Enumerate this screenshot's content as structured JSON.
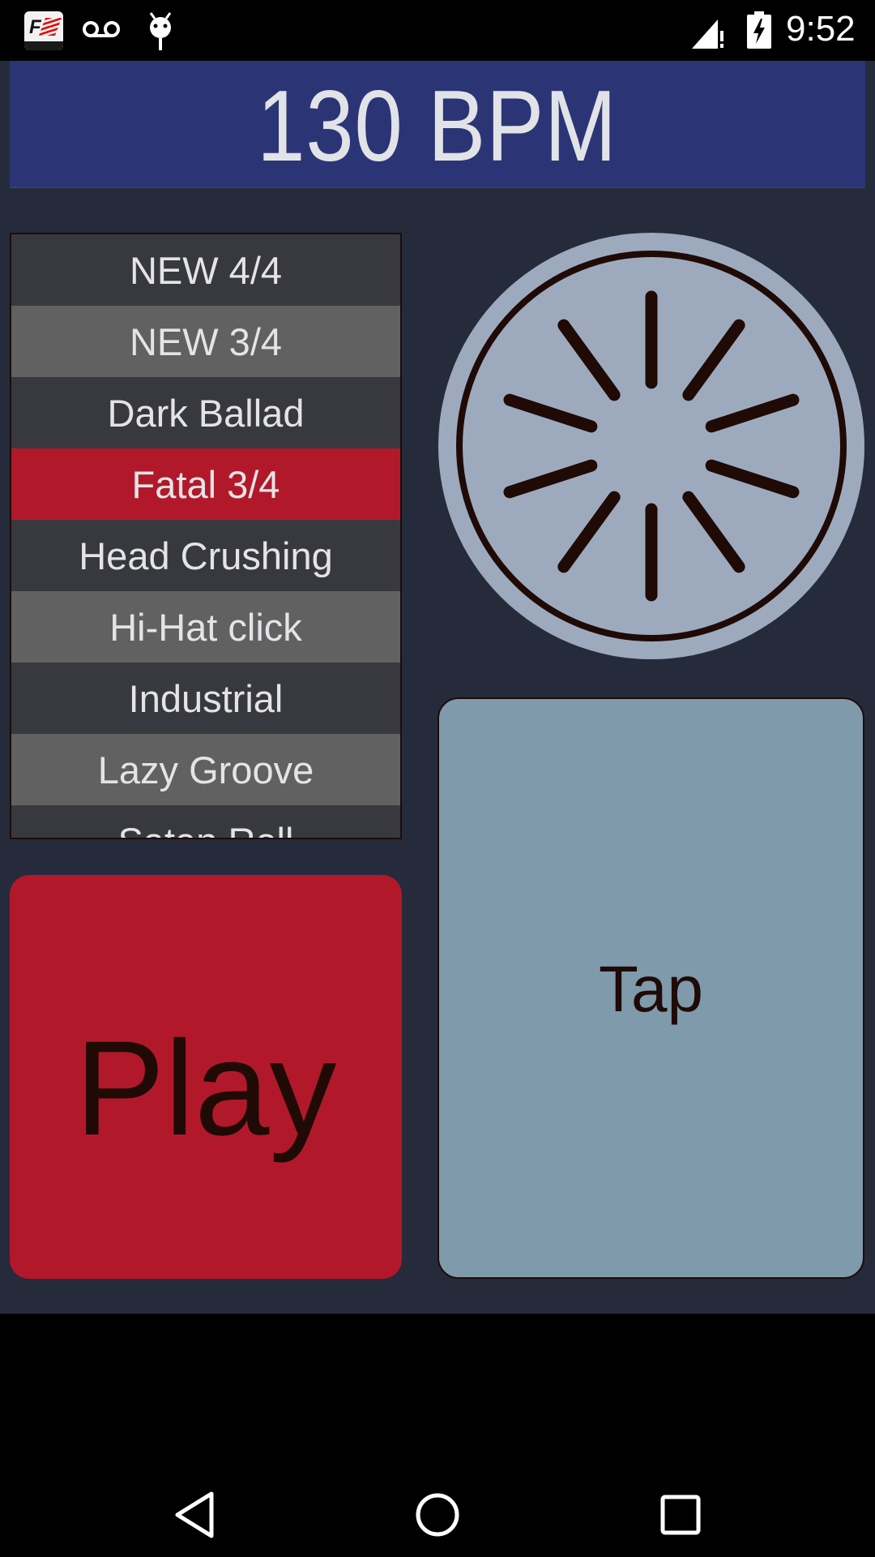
{
  "status_bar": {
    "time": "9:52",
    "notification_icons": [
      "f1-app-icon",
      "voicemail-icon",
      "android-debug-icon"
    ],
    "system_icons": [
      "signal-no-sim-icon",
      "battery-charging-icon"
    ]
  },
  "header": {
    "bpm_display": "130 BPM"
  },
  "pattern_list": {
    "items": [
      {
        "label": "NEW 4/4",
        "style": "dark"
      },
      {
        "label": "NEW 3/4",
        "style": "light"
      },
      {
        "label": "Dark Ballad",
        "style": "dark"
      },
      {
        "label": "Fatal 3/4",
        "style": "selected"
      },
      {
        "label": "Head Crushing",
        "style": "dark"
      },
      {
        "label": "Hi-Hat click",
        "style": "light"
      },
      {
        "label": "Industrial",
        "style": "dark"
      },
      {
        "label": "Lazy Groove",
        "style": "light"
      },
      {
        "label": "Satan Roll",
        "style": "dark"
      }
    ],
    "selected": "Fatal 3/4"
  },
  "dial": {
    "icon": "tempo-dial-icon",
    "spoke_count": 10
  },
  "buttons": {
    "play_label": "Play",
    "tap_label": "Tap"
  },
  "nav_bar": {
    "back": "back-icon",
    "home": "home-icon",
    "recents": "recents-icon"
  },
  "colors": {
    "background": "#252b3a",
    "header": "#2b3576",
    "accent_red": "#b1192a",
    "tap_blue": "#7e9aab",
    "dial_face": "#9daabe",
    "dark_ink": "#1f0a06"
  }
}
